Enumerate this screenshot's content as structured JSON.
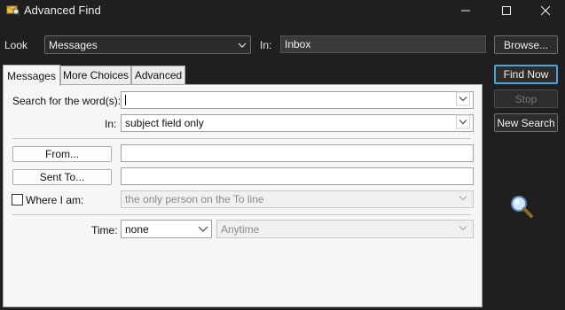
{
  "window": {
    "title": "Advanced Find",
    "icon": "advanced-find-icon"
  },
  "controls": {
    "minimize": "minimize-icon",
    "maximize": "maximize-icon",
    "close": "close-icon"
  },
  "look": {
    "label": "Look",
    "value": "Messages",
    "in_label": "In:",
    "in_value": "Inbox",
    "browse_label": "Browse..."
  },
  "tabs": [
    {
      "label": "Messages",
      "active": true
    },
    {
      "label": "More Choices",
      "active": false
    },
    {
      "label": "Advanced",
      "active": false
    }
  ],
  "messages_tab": {
    "search_label": "Search for the word(s):",
    "search_value": "",
    "in_label": "In:",
    "in_value": "subject field only",
    "from_button": "From...",
    "from_value": "",
    "sent_to_button": "Sent To...",
    "sent_to_value": "",
    "where_label": "Where I am:",
    "where_checked": false,
    "where_value": "the only person on the To line",
    "time_label": "Time:",
    "time_value": "none",
    "time_range_value": "Anytime"
  },
  "side_buttons": {
    "find_now": "Find Now",
    "stop": "Stop",
    "new_search": "New Search"
  },
  "search_graphic": "magnifier-icon"
}
